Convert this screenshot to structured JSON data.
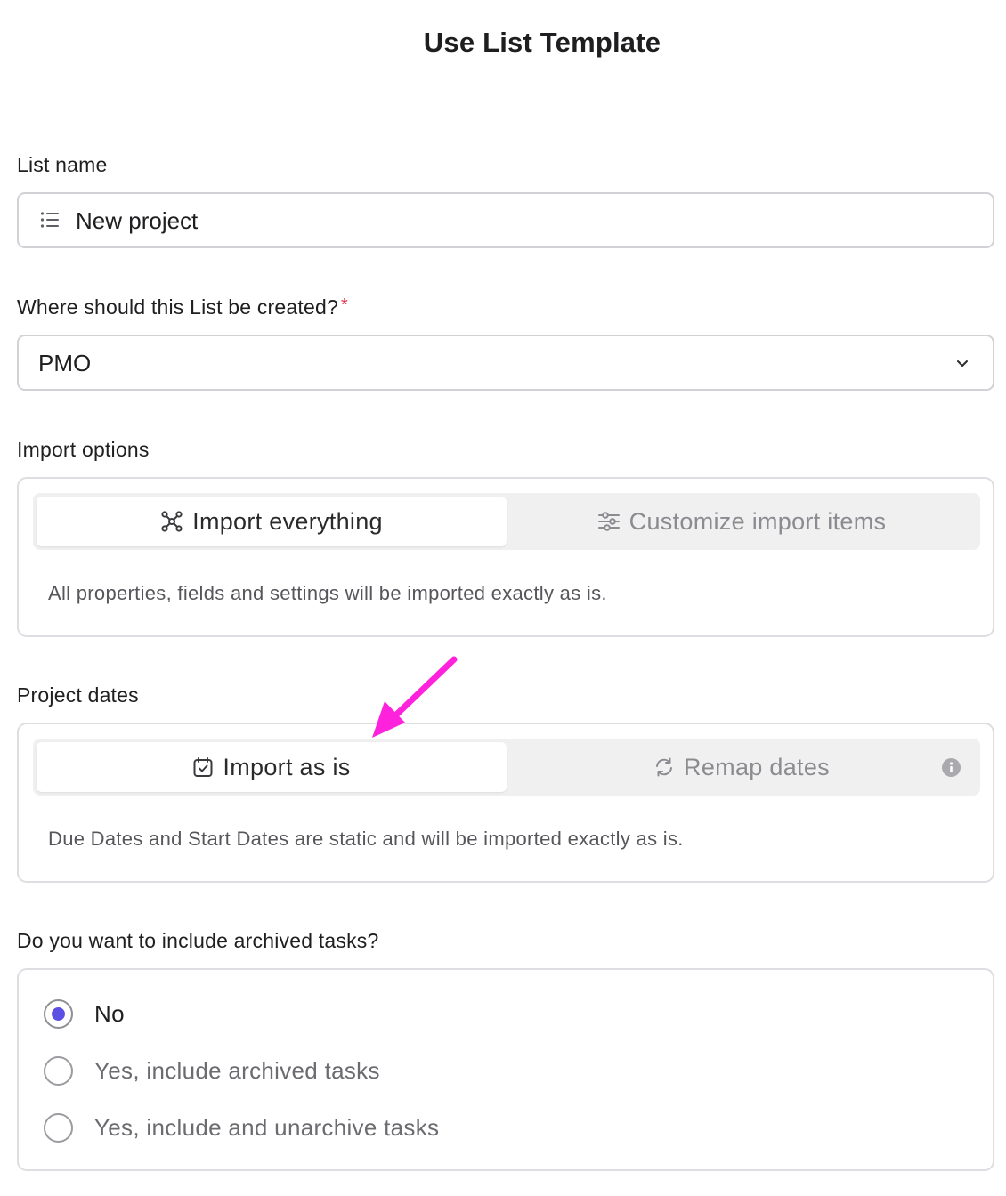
{
  "header": {
    "title": "Use List Template"
  },
  "list_name": {
    "label": "List name",
    "value": "New project",
    "icon": "list-icon"
  },
  "location": {
    "label": "Where should this List be created?",
    "required_mark": "*",
    "value": "PMO"
  },
  "import_options": {
    "label": "Import options",
    "options": [
      {
        "label": "Import everything",
        "icon": "network-icon",
        "selected": true
      },
      {
        "label": "Customize import items",
        "icon": "sliders-icon",
        "selected": false
      }
    ],
    "description": "All properties, fields and settings will be imported exactly as is."
  },
  "project_dates": {
    "label": "Project dates",
    "options": [
      {
        "label": "Import as is",
        "icon": "calendar-check-icon",
        "selected": true
      },
      {
        "label": "Remap dates",
        "icon": "refresh-icon",
        "selected": false
      }
    ],
    "description": "Due Dates and Start Dates are static and will be imported exactly as is."
  },
  "archived": {
    "label": "Do you want to include archived tasks?",
    "options": [
      {
        "label": "No",
        "selected": true
      },
      {
        "label": "Yes, include archived tasks",
        "selected": false
      },
      {
        "label": "Yes, include and unarchive tasks",
        "selected": false
      }
    ]
  },
  "colors": {
    "accent": "#5b4fe4",
    "arrow": "#ff22dd",
    "required": "#d9344b"
  }
}
